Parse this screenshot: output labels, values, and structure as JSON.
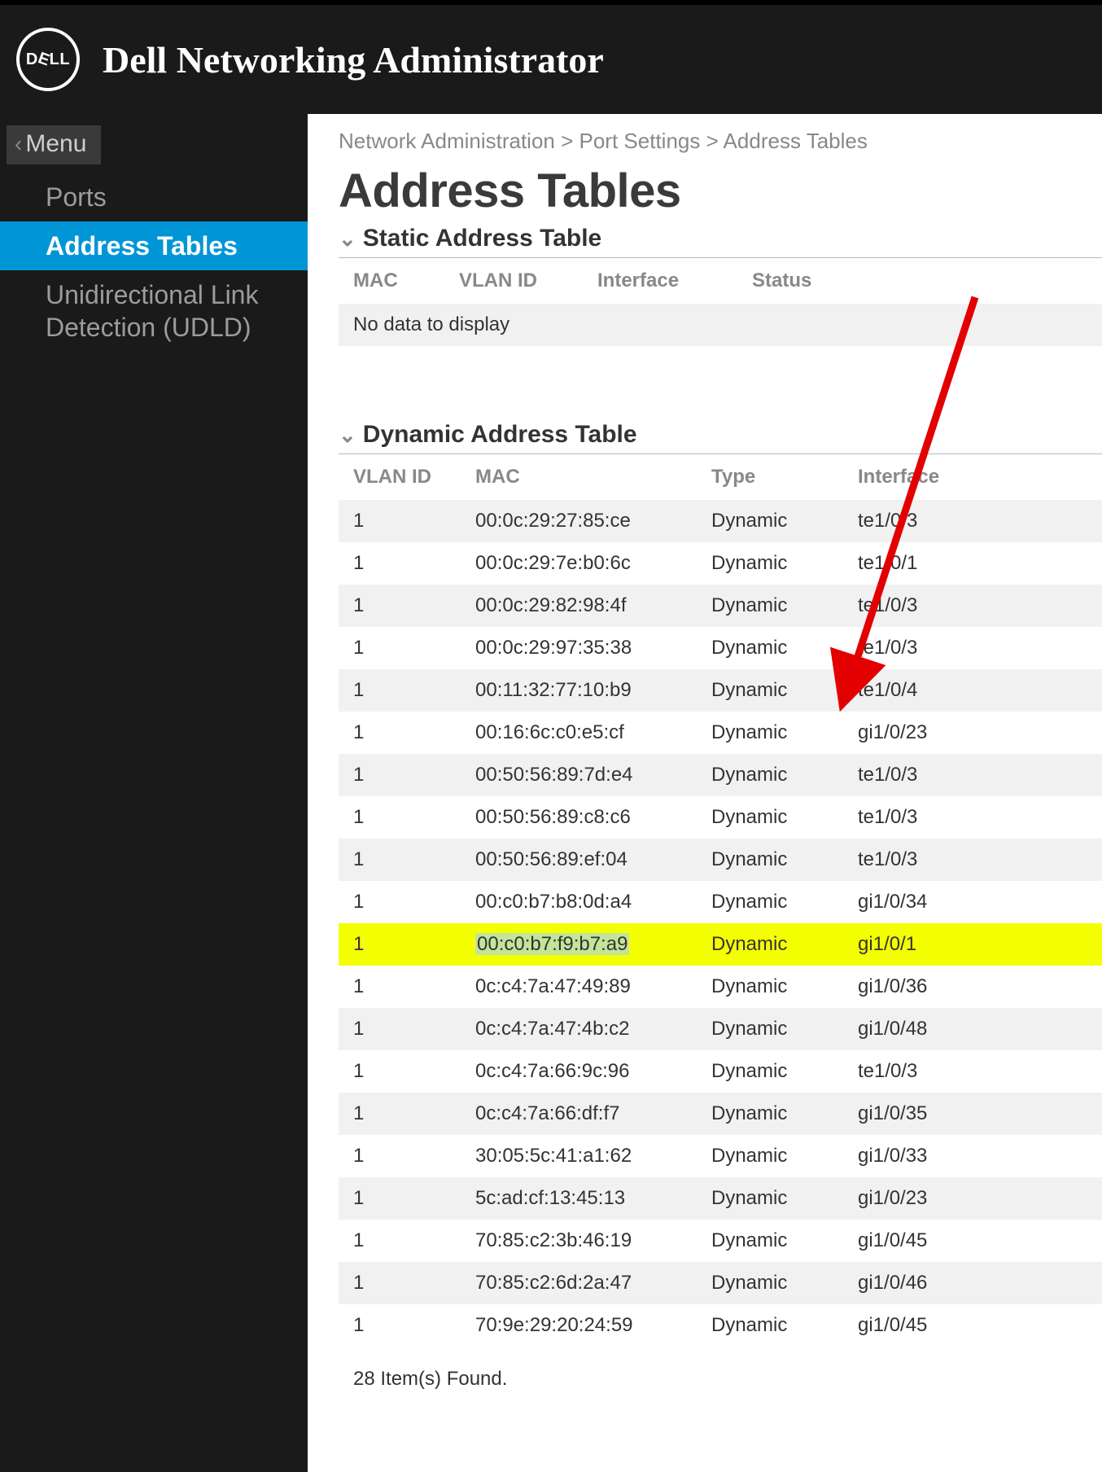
{
  "header": {
    "logo_text": "DELL",
    "app_title": "Dell Networking Administrator"
  },
  "sidebar": {
    "back_label": "Menu",
    "items": [
      {
        "label": "Ports",
        "active": false
      },
      {
        "label": "Address Tables",
        "active": true
      },
      {
        "label": "Unidirectional Link Detection (UDLD)",
        "active": false
      }
    ]
  },
  "breadcrumb": {
    "items": [
      "Network Administration",
      "Port Settings",
      "Address Tables"
    ],
    "separator": " > "
  },
  "page_title": "Address Tables",
  "static_table": {
    "title": "Static Address Table",
    "columns": [
      "MAC",
      "VLAN ID",
      "Interface",
      "Status"
    ],
    "no_data_text": "No data to display"
  },
  "dynamic_table": {
    "title": "Dynamic Address Table",
    "columns": [
      "VLAN ID",
      "MAC",
      "Type",
      "Interface"
    ],
    "rows": [
      {
        "vlan": "1",
        "mac": "00:0c:29:27:85:ce",
        "type": "Dynamic",
        "iface": "te1/0/3",
        "highlight": false
      },
      {
        "vlan": "1",
        "mac": "00:0c:29:7e:b0:6c",
        "type": "Dynamic",
        "iface": "te1/0/1",
        "highlight": false
      },
      {
        "vlan": "1",
        "mac": "00:0c:29:82:98:4f",
        "type": "Dynamic",
        "iface": "te1/0/3",
        "highlight": false
      },
      {
        "vlan": "1",
        "mac": "00:0c:29:97:35:38",
        "type": "Dynamic",
        "iface": "te1/0/3",
        "highlight": false
      },
      {
        "vlan": "1",
        "mac": "00:11:32:77:10:b9",
        "type": "Dynamic",
        "iface": "te1/0/4",
        "highlight": false
      },
      {
        "vlan": "1",
        "mac": "00:16:6c:c0:e5:cf",
        "type": "Dynamic",
        "iface": "gi1/0/23",
        "highlight": false
      },
      {
        "vlan": "1",
        "mac": "00:50:56:89:7d:e4",
        "type": "Dynamic",
        "iface": "te1/0/3",
        "highlight": false
      },
      {
        "vlan": "1",
        "mac": "00:50:56:89:c8:c6",
        "type": "Dynamic",
        "iface": "te1/0/3",
        "highlight": false
      },
      {
        "vlan": "1",
        "mac": "00:50:56:89:ef:04",
        "type": "Dynamic",
        "iface": "te1/0/3",
        "highlight": false
      },
      {
        "vlan": "1",
        "mac": "00:c0:b7:b8:0d:a4",
        "type": "Dynamic",
        "iface": "gi1/0/34",
        "highlight": false
      },
      {
        "vlan": "1",
        "mac": "00:c0:b7:f9:b7:a9",
        "type": "Dynamic",
        "iface": "gi1/0/1",
        "highlight": true
      },
      {
        "vlan": "1",
        "mac": "0c:c4:7a:47:49:89",
        "type": "Dynamic",
        "iface": "gi1/0/36",
        "highlight": false
      },
      {
        "vlan": "1",
        "mac": "0c:c4:7a:47:4b:c2",
        "type": "Dynamic",
        "iface": "gi1/0/48",
        "highlight": false
      },
      {
        "vlan": "1",
        "mac": "0c:c4:7a:66:9c:96",
        "type": "Dynamic",
        "iface": "te1/0/3",
        "highlight": false
      },
      {
        "vlan": "1",
        "mac": "0c:c4:7a:66:df:f7",
        "type": "Dynamic",
        "iface": "gi1/0/35",
        "highlight": false
      },
      {
        "vlan": "1",
        "mac": "30:05:5c:41:a1:62",
        "type": "Dynamic",
        "iface": "gi1/0/33",
        "highlight": false
      },
      {
        "vlan": "1",
        "mac": "5c:ad:cf:13:45:13",
        "type": "Dynamic",
        "iface": "gi1/0/23",
        "highlight": false
      },
      {
        "vlan": "1",
        "mac": "70:85:c2:3b:46:19",
        "type": "Dynamic",
        "iface": "gi1/0/45",
        "highlight": false
      },
      {
        "vlan": "1",
        "mac": "70:85:c2:6d:2a:47",
        "type": "Dynamic",
        "iface": "gi1/0/46",
        "highlight": false
      },
      {
        "vlan": "1",
        "mac": "70:9e:29:20:24:59",
        "type": "Dynamic",
        "iface": "gi1/0/45",
        "highlight": false
      }
    ],
    "footer_count_text": "28 Item(s) Found."
  },
  "annotation": {
    "arrow_color": "#e20000"
  }
}
